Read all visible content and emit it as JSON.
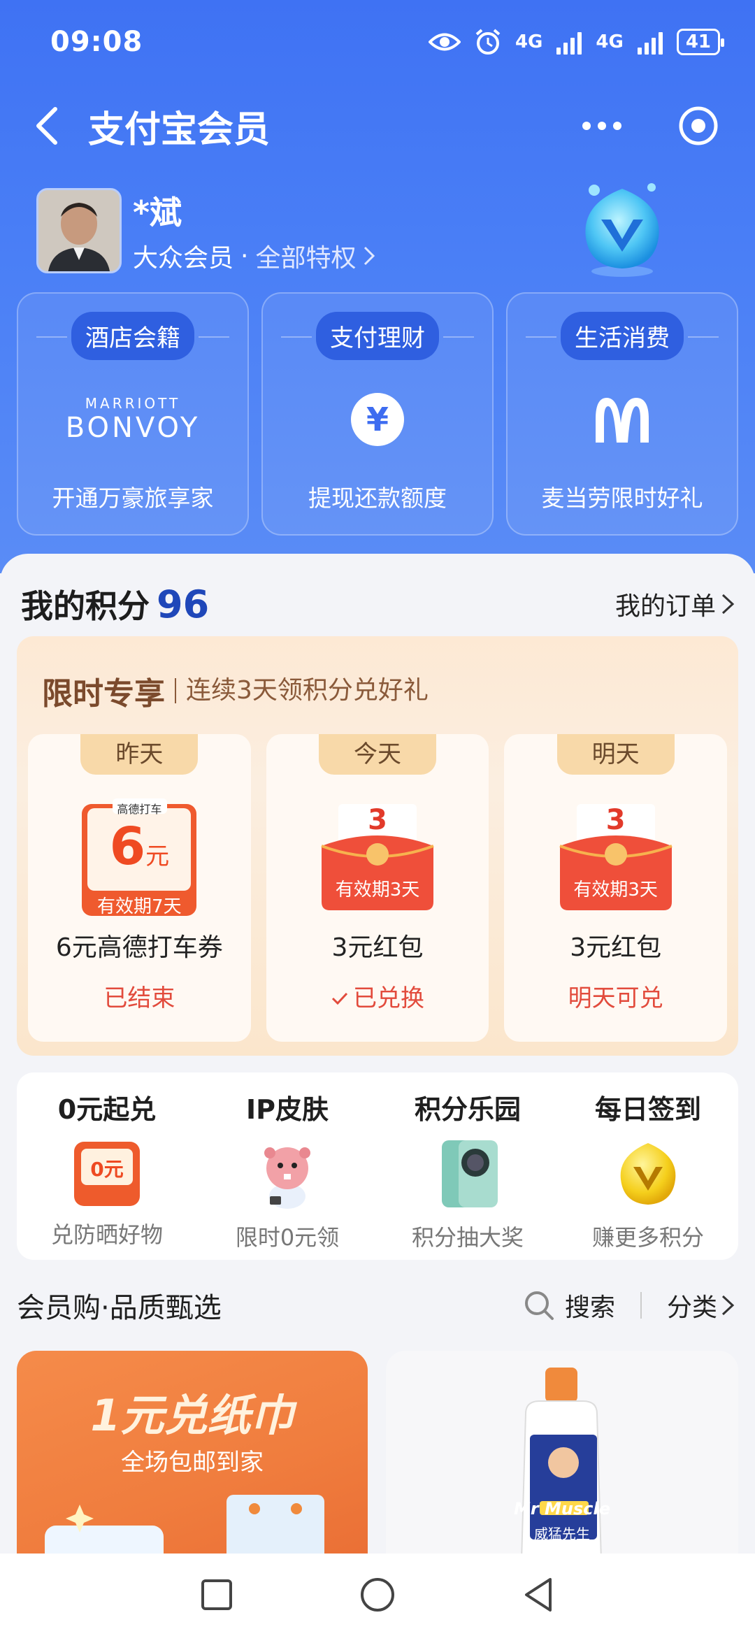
{
  "status": {
    "time": "09:08",
    "net1": "4G",
    "net2": "4G",
    "battery": "41"
  },
  "nav": {
    "title": "支付宝会员"
  },
  "profile": {
    "name": "*斌",
    "level": "大众会员",
    "sep": "·",
    "privileges": "全部特权"
  },
  "privilege_cards": [
    {
      "tag": "酒店会籍",
      "logo_line1": "MARRIOTT",
      "logo_line2": "BONVOY",
      "caption": "开通万豪旅享家"
    },
    {
      "tag": "支付理财",
      "logo_symbol": "¥",
      "caption": "提现还款额度"
    },
    {
      "tag": "生活消费",
      "logo_symbol": "M",
      "caption": "麦当劳限时好礼"
    }
  ],
  "points": {
    "title": "我的积分",
    "value": "96",
    "orders_label": "我的订单"
  },
  "promo": {
    "title": "限时专享",
    "subtitle": "连续3天领积分兑好礼",
    "days": [
      {
        "label": "昨天",
        "ticket_brand": "高德打车",
        "ticket_amount": "6",
        "ticket_unit": "元",
        "ticket_validity": "有效期7天",
        "item": "6元高德打车券",
        "status": "已结束"
      },
      {
        "label": "今天",
        "ticket_amount": "3",
        "ticket_validity": "有效期3天",
        "item": "3元红包",
        "status": "已兑换"
      },
      {
        "label": "明天",
        "ticket_amount": "3",
        "ticket_validity": "有效期3天",
        "item": "3元红包",
        "status": "明天可兑"
      }
    ]
  },
  "quick": [
    {
      "title": "0元起兑",
      "icon_text": "0元",
      "sub": "兑防晒好物"
    },
    {
      "title": "IP皮肤",
      "sub": "限时0元领"
    },
    {
      "title": "积分乐园",
      "sub": "积分抽大奖"
    },
    {
      "title": "每日签到",
      "sub": "赚更多积分"
    }
  ],
  "shop": {
    "title": "会员购·品质甄选",
    "search_label": "搜索",
    "category_label": "分类"
  },
  "products": {
    "left_title": "1元兑纸巾",
    "left_sub": "全场包邮到家",
    "right_brand": "Mr Muscle",
    "right_label": "威猛先生"
  },
  "colors": {
    "header_blue": "#4a7ff6",
    "points_blue": "#1f47b9",
    "status_red": "#e24b3c",
    "promo_orange": "#f07d3e"
  }
}
